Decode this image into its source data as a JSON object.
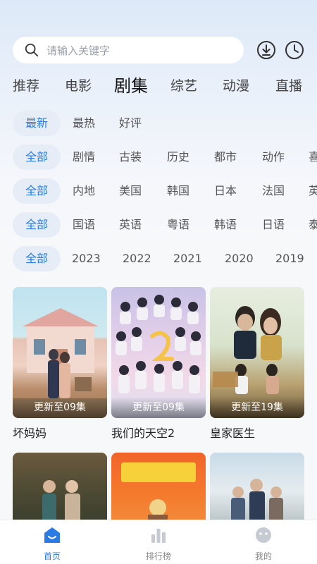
{
  "search": {
    "placeholder": "请输入关键字"
  },
  "tabs": [
    {
      "label": "推荐"
    },
    {
      "label": "电影"
    },
    {
      "label": "剧集"
    },
    {
      "label": "综艺"
    },
    {
      "label": "动漫"
    },
    {
      "label": "直播"
    }
  ],
  "active_tab": "剧集",
  "filters": {
    "sort": [
      "最新",
      "最热",
      "好评"
    ],
    "genre": [
      "全部",
      "剧情",
      "古装",
      "历史",
      "都市",
      "动作",
      "喜"
    ],
    "region": [
      "全部",
      "内地",
      "美国",
      "韩国",
      "日本",
      "法国",
      "英"
    ],
    "language": [
      "全部",
      "国语",
      "英语",
      "粤语",
      "韩语",
      "日语",
      "泰"
    ],
    "year": [
      "全部",
      "2023",
      "2022",
      "2021",
      "2020",
      "2019"
    ]
  },
  "cards": [
    {
      "title": "坏妈妈",
      "badge": "更新至09集"
    },
    {
      "title": "我们的天空2",
      "badge": "更新至09集"
    },
    {
      "title": "皇家医生",
      "badge": "更新至19集"
    }
  ],
  "bottom_nav": [
    {
      "label": "首页",
      "icon": "home-icon"
    },
    {
      "label": "排行榜",
      "icon": "ranking-icon"
    },
    {
      "label": "我的",
      "icon": "profile-icon"
    }
  ],
  "colors": {
    "accent": "#2b7be6",
    "chip_bg": "#e6edf7"
  }
}
